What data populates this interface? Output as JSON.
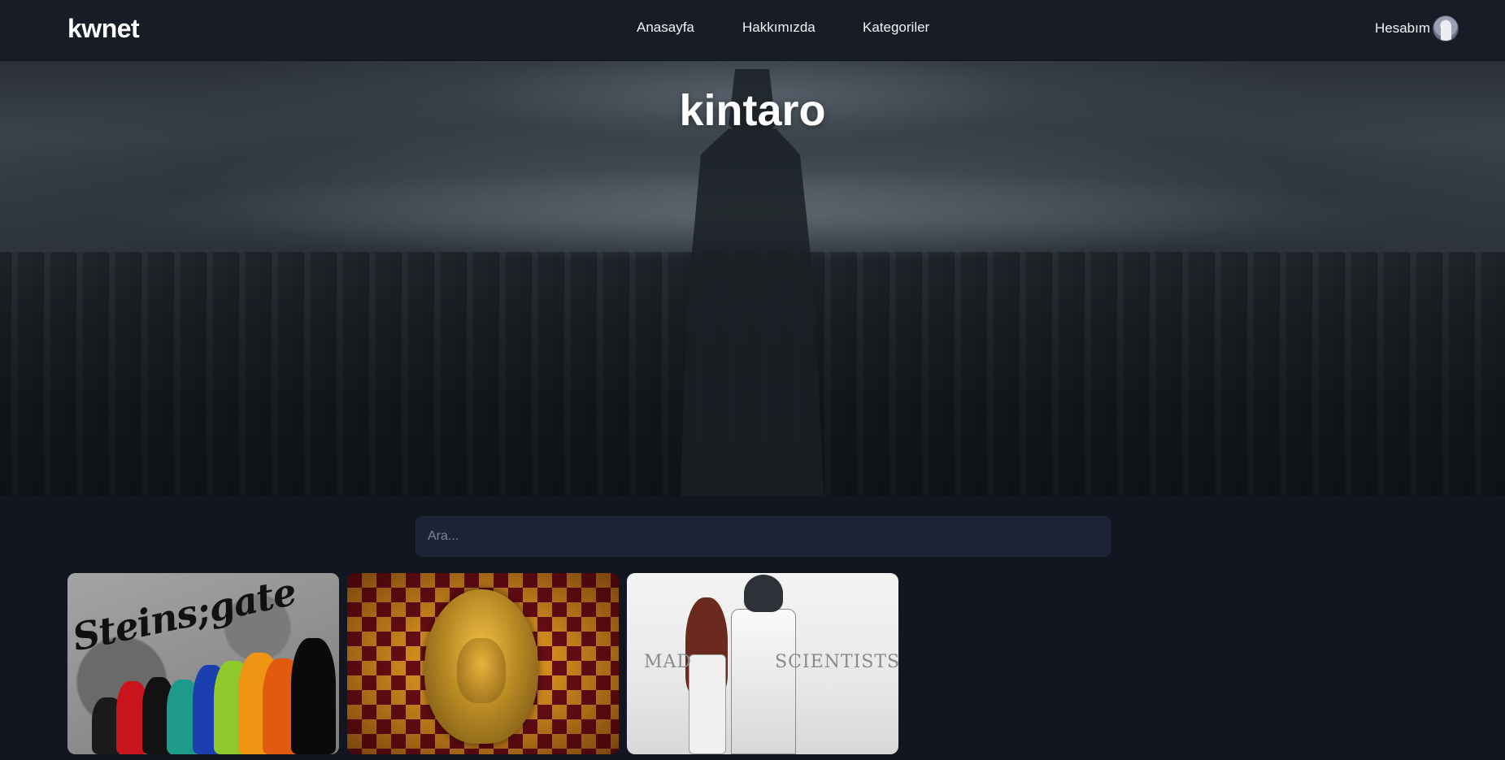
{
  "navbar": {
    "logo": "kwnet",
    "links": [
      "Anasayfa",
      "Hakkımızda",
      "Kategoriler"
    ],
    "account_label": "Hesabım",
    "account_icon": "user-avatar-icon"
  },
  "hero": {
    "title": "kintaro"
  },
  "search": {
    "placeholder": "Ara..."
  },
  "cards": [
    {
      "image": "steins-gate-group-art",
      "text": "Steins;gate"
    },
    {
      "image": "golden-face-emblem-on-red-gold-diamonds"
    },
    {
      "image": "mad-scientists-art",
      "text_left": "MAD",
      "text_right": "SCIENTISTS"
    }
  ],
  "colors": {
    "background": "#121620",
    "navbar": "#181c26",
    "search_bg": "#1b2334",
    "text": "#ffffff"
  }
}
